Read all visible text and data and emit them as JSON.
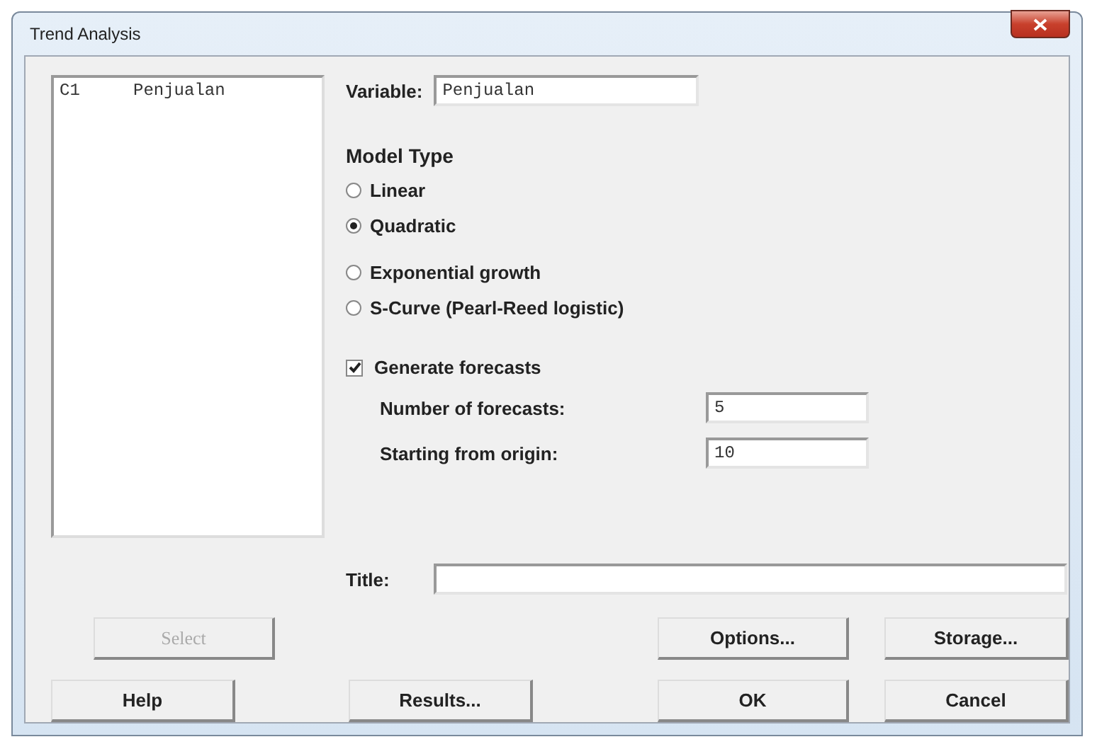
{
  "window": {
    "title": "Trend Analysis"
  },
  "variable_list": [
    {
      "column": "C1",
      "name": "Penjualan"
    }
  ],
  "variable": {
    "label": "Variable:",
    "value": "Penjualan"
  },
  "model_type": {
    "label": "Model Type",
    "options": [
      {
        "label": "Linear",
        "selected": false
      },
      {
        "label": "Quadratic",
        "selected": true
      },
      {
        "label": "Exponential growth",
        "selected": false
      },
      {
        "label": "S-Curve (Pearl-Reed logistic)",
        "selected": false
      }
    ]
  },
  "generate_forecasts": {
    "label": "Generate forecasts",
    "checked": true
  },
  "forecast_fields": [
    {
      "label": "Number of forecasts:",
      "value": "5"
    },
    {
      "label": "Starting from origin:",
      "value": "10"
    }
  ],
  "title_field": {
    "label": "Title:"
  },
  "buttons_row_1": [
    {
      "label": "Select",
      "disabled": true
    },
    {
      "label": "Options...",
      "disabled": false
    },
    {
      "label": "Storage...",
      "disabled": false
    }
  ],
  "buttons_row_2": [
    {
      "label": "Help",
      "disabled": false
    },
    {
      "label": "Results...",
      "disabled": false
    },
    {
      "label": "OK",
      "disabled": false
    },
    {
      "label": "Cancel",
      "disabled": false
    }
  ]
}
